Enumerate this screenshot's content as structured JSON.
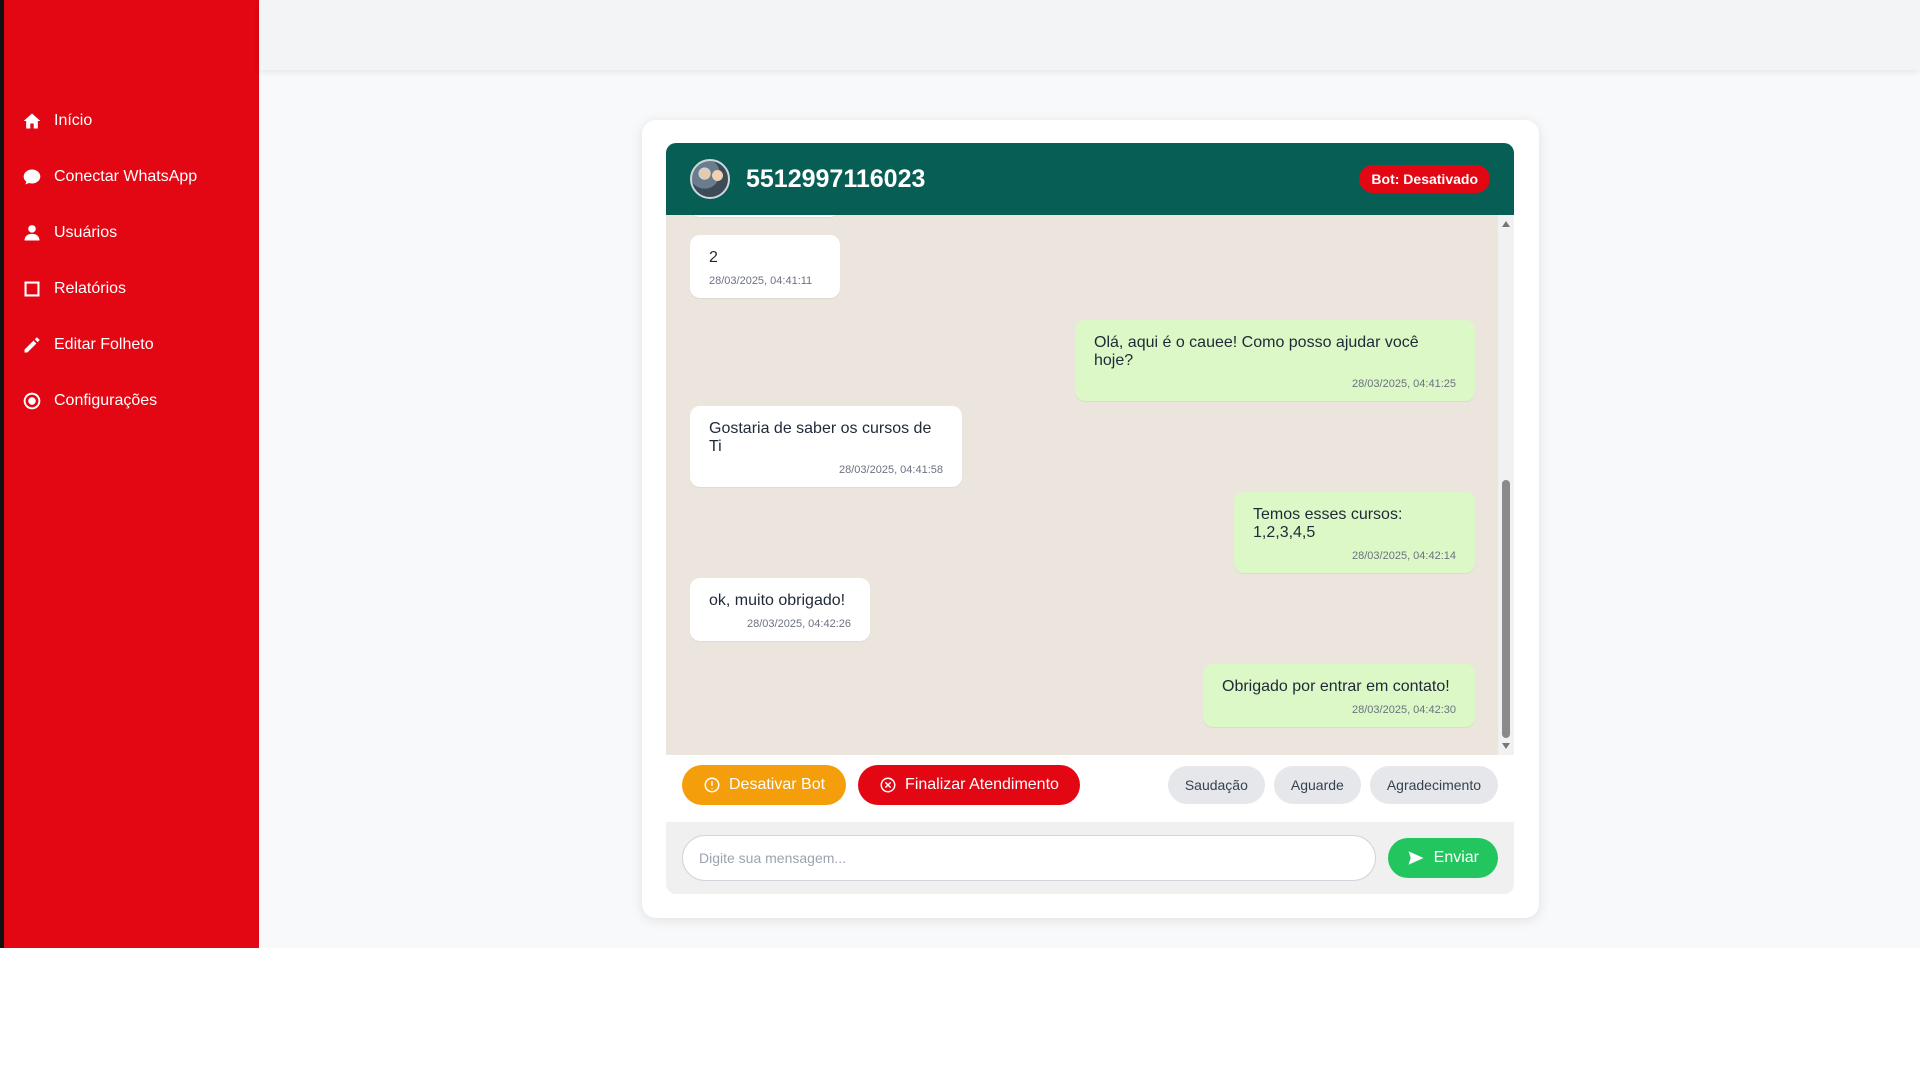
{
  "sidebar": {
    "items": [
      {
        "label": "Início",
        "icon": "home-icon"
      },
      {
        "label": "Conectar WhatsApp",
        "icon": "chat-bubble-icon"
      },
      {
        "label": "Usuários",
        "icon": "user-icon"
      },
      {
        "label": "Relatórios",
        "icon": "square-icon"
      },
      {
        "label": "Editar Folheto",
        "icon": "pencil-icon"
      },
      {
        "label": "Configurações",
        "icon": "gear-icon"
      }
    ]
  },
  "chat": {
    "contact": "5512997116023",
    "bot_status": "Bot: Desativado",
    "messages": [
      {
        "direction": "in",
        "text": "2",
        "time": "28/03/2025, 04:41:11"
      },
      {
        "direction": "out",
        "text": "Olá, aqui é o cauee! Como posso ajudar você hoje?",
        "time": "28/03/2025, 04:41:25"
      },
      {
        "direction": "in",
        "text": "Gostaria de saber os cursos de Ti",
        "time": "28/03/2025, 04:41:58"
      },
      {
        "direction": "out",
        "text": "Temos esses cursos: 1,2,3,4,5",
        "time": "28/03/2025, 04:42:14"
      },
      {
        "direction": "in",
        "text": "ok, muito obrigado!",
        "time": "28/03/2025, 04:42:26"
      },
      {
        "direction": "out",
        "text": "Obrigado por entrar em contato!",
        "time": "28/03/2025, 04:42:30"
      }
    ]
  },
  "actions": {
    "disable_bot": "Desativar Bot",
    "finish": "Finalizar Atendimento",
    "quick_replies": [
      "Saudação",
      "Aguarde",
      "Agradecimento"
    ]
  },
  "composer": {
    "placeholder": "Digite sua mensagem...",
    "value": "",
    "send_label": "Enviar"
  },
  "colors": {
    "sidebar": "#e30613",
    "header": "#075e54",
    "outgoing_bubble": "#dcf8c6",
    "chat_bg": "#ece5dd",
    "warning": "#f59e0b",
    "send": "#22c55e"
  }
}
